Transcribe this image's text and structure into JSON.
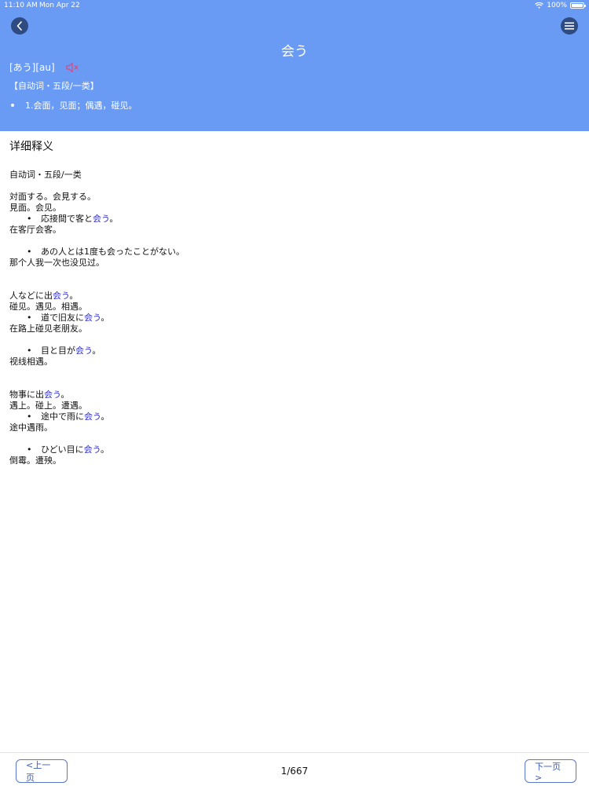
{
  "status_bar": {
    "time": "11:10 AM",
    "date": "Mon Apr 22",
    "battery": "100%"
  },
  "header": {
    "title": "会う",
    "reading": "[あう][au]",
    "pos": "【自动词・五段/一类】",
    "meaning": "1.会面，见面；偶遇，碰见。",
    "bg_color": "#6a9bf4"
  },
  "detail": {
    "title": "详细释义",
    "pos": "自动词・五段/一类",
    "sections": [
      {
        "lines": [
          "対面する。会見する。",
          "見面。会见。"
        ],
        "examples": [
          {
            "pre": "応接間で客と",
            "hl": "会う",
            "post": "。",
            "translation": "在客厅会客。"
          },
          {
            "pre": "あの人とは1度も会ったことがない。",
            "hl": "",
            "post": "",
            "translation": "那个人我一次也没见过。"
          }
        ]
      },
      {
        "lines_first": {
          "pre": "人などに出",
          "hl": "会う",
          "post": "。"
        },
        "lines": [
          "碰见。遇见。相遇。"
        ],
        "examples": [
          {
            "pre": "道で旧友に",
            "hl": "会う",
            "post": "。",
            "translation": "在路上碰见老朋友。"
          },
          {
            "pre": "目と目が",
            "hl": "会う",
            "post": "。",
            "translation": "视线相遇。"
          }
        ]
      },
      {
        "lines_first": {
          "pre": "物事に出",
          "hl": "会う",
          "post": "。"
        },
        "lines": [
          "遇上。碰上。遭遇。"
        ],
        "examples": [
          {
            "pre": "途中で雨に",
            "hl": "会う",
            "post": "。",
            "translation": "途中遇雨。"
          },
          {
            "pre": "ひどい目に",
            "hl": "会う",
            "post": "。",
            "translation": "倒霉。遭殃。"
          }
        ]
      }
    ]
  },
  "footer": {
    "prev_label": "<上一页",
    "next_label": "下一页>",
    "page": "1/667"
  },
  "icons": {
    "back": "chevron-left-icon",
    "menu": "menu-icon",
    "speaker": "speaker-muted-icon",
    "wifi": "wifi-icon",
    "battery": "battery-icon"
  }
}
